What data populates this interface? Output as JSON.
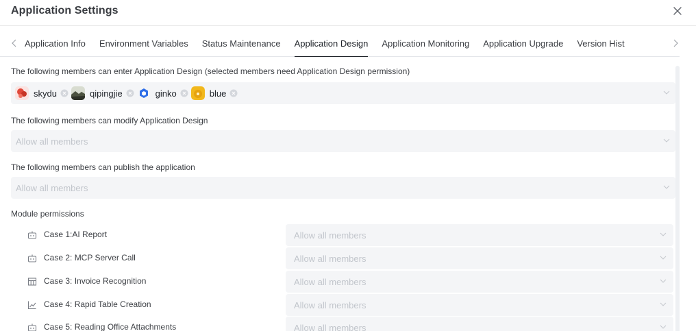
{
  "dialog": {
    "title": "Application Settings"
  },
  "tabs": [
    {
      "label": "Application Info"
    },
    {
      "label": "Environment Variables"
    },
    {
      "label": "Status Maintenance"
    },
    {
      "label": "Application Design",
      "active": true
    },
    {
      "label": "Application Monitoring"
    },
    {
      "label": "Application Upgrade"
    },
    {
      "label": "Version Hist"
    }
  ],
  "enter_design": {
    "label": "The following members can enter Application Design (selected members need Application Design permission)",
    "members": [
      {
        "name": "skydu",
        "icon": "red-flower-avatar"
      },
      {
        "name": "qipingjie",
        "icon": "landscape-avatar"
      },
      {
        "name": "ginko",
        "icon": "blue-hexagon-avatar"
      },
      {
        "name": "blue",
        "icon": "yellow-coin-avatar"
      }
    ]
  },
  "modify_design": {
    "label": "The following members can modify Application Design",
    "placeholder": "Allow all members"
  },
  "publish_app": {
    "label": "The following members can publish the application",
    "placeholder": "Allow all members"
  },
  "modules": {
    "label": "Module permissions",
    "items": [
      {
        "label": "Case 1:AI Report",
        "icon": "robot-icon",
        "placeholder": "Allow all members"
      },
      {
        "label": "Case 2: MCP Server Call",
        "icon": "robot-icon",
        "placeholder": "Allow all members"
      },
      {
        "label": "Case 3: Invoice Recognition",
        "icon": "table-icon",
        "placeholder": "Allow all members"
      },
      {
        "label": "Case 4: Rapid Table Creation",
        "icon": "line-chart-icon",
        "placeholder": "Allow all members"
      },
      {
        "label": "Case 5: Reading Office Attachments",
        "icon": "robot-icon",
        "placeholder": "Allow all members"
      }
    ]
  },
  "colors": {
    "active_tab_underline": "#1f2329",
    "field_background": "#f4f5f7",
    "placeholder_text": "#c2c6cc"
  }
}
